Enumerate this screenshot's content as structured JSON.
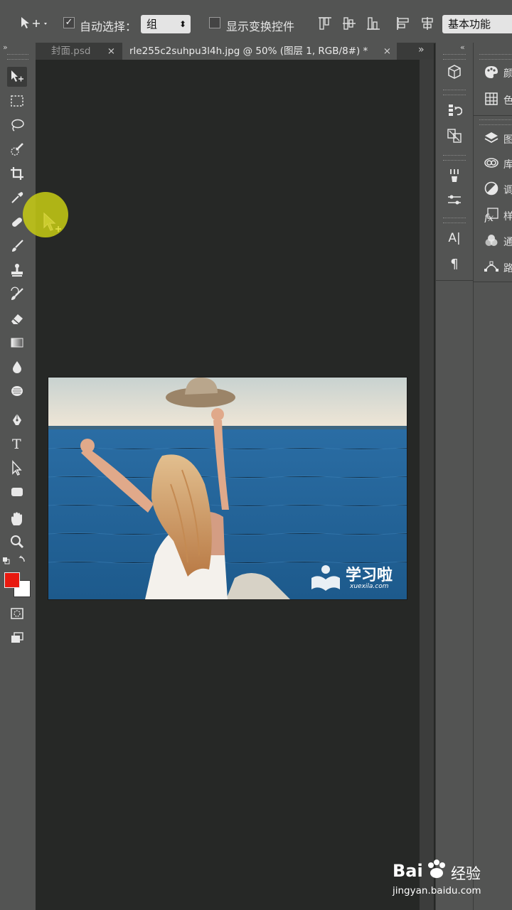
{
  "options_bar": {
    "auto_select_label": "自动选择：",
    "auto_select_checked": true,
    "group_select_value": "组",
    "show_transform_label": "显示变换控件",
    "show_transform_checked": false,
    "workspace_value": "基本功能"
  },
  "tabs": [
    {
      "label": "封面.psd",
      "close": "×",
      "active": false
    },
    {
      "label": "rle255c2suhpu3l4h.jpg @ 50% (图层 1, RGB/8#) *",
      "close": "×",
      "active": true
    }
  ],
  "tab_overflow": "»",
  "panel_collapse": "«",
  "toolbar_collapse": "»",
  "tools": [
    {
      "icon": "move-tool-icon"
    },
    {
      "icon": "rectangular-marquee-icon"
    },
    {
      "icon": "lasso-icon"
    },
    {
      "icon": "quick-selection-icon"
    },
    {
      "icon": "crop-icon"
    },
    {
      "icon": "eyedropper-icon"
    },
    {
      "icon": "spot-healing-icon"
    },
    {
      "icon": "brush-icon"
    },
    {
      "icon": "clone-stamp-icon"
    },
    {
      "icon": "history-brush-icon"
    },
    {
      "icon": "eraser-icon"
    },
    {
      "icon": "gradient-icon"
    },
    {
      "icon": "blur-icon"
    },
    {
      "icon": "dodge-icon"
    },
    {
      "icon": "pen-icon"
    },
    {
      "icon": "type-icon"
    },
    {
      "icon": "path-selection-icon"
    },
    {
      "icon": "rectangle-shape-icon"
    },
    {
      "icon": "hand-icon"
    },
    {
      "icon": "zoom-icon"
    }
  ],
  "colors": {
    "foreground": "#e8190f",
    "background": "#ffffff",
    "ui_panel": "#535453",
    "canvas_bg": "#262826"
  },
  "right_panels": [
    {
      "icon": "color-palette-icon",
      "label": "颜"
    },
    {
      "icon": "swatches-grid-icon",
      "label": "色"
    },
    {
      "icon": "layers-icon",
      "label": "图"
    },
    {
      "icon": "libraries-icon",
      "label": "库"
    },
    {
      "icon": "adjustments-icon",
      "label": "调"
    },
    {
      "icon": "styles-fx-icon",
      "label": "样"
    },
    {
      "icon": "channels-icon",
      "label": "通"
    },
    {
      "icon": "paths-icon",
      "label": "路"
    }
  ],
  "mid_panel_text": {
    "character_icon": "A|",
    "paragraph_icon": "¶"
  },
  "photo": {
    "watermark_title": "学习啦",
    "watermark_sub": "xuexila.com"
  },
  "baidu_watermark": {
    "brand": "Bai",
    "brand_suffix": "经验",
    "url": "jingyan.baidu.com"
  }
}
